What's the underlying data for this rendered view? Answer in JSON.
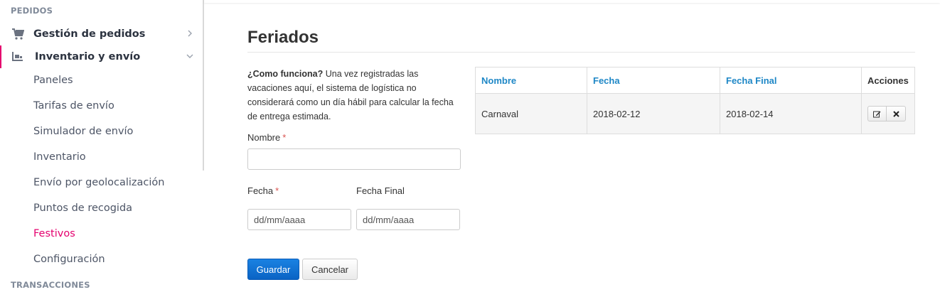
{
  "sidebar": {
    "section_orders": "PEDIDOS",
    "group_orders": "Gestión de pedidos",
    "group_inventory": "Inventario y envío",
    "items": [
      "Paneles",
      "Tarifas de envío",
      "Simulador de envío",
      "Inventario",
      "Envío por geolocalización",
      "Puntos de recogida",
      "Festivos",
      "Configuración"
    ],
    "section_transactions": "TRANSACCIONES",
    "active_item": "Festivos"
  },
  "page": {
    "title": "Feriados",
    "help_bold": "¿Como funciona?",
    "help_text": " Una vez registradas las vacaciones aquí, el sistema de logística no considerará como un día hábil para calcular la fecha de entrega estimada."
  },
  "form": {
    "name_label": "Nombre",
    "name_value": "",
    "date_label": "Fecha",
    "date_placeholder": "dd/mm/aaaa",
    "end_date_label": "Fecha Final",
    "end_date_placeholder": "dd/mm/aaaa",
    "required_mark": "*",
    "save_label": "Guardar",
    "cancel_label": "Cancelar"
  },
  "table": {
    "headers": [
      "Nombre",
      "Fecha",
      "Fecha Final",
      "Acciones"
    ],
    "rows": [
      {
        "name": "Carnaval",
        "date": "2018-02-12",
        "end_date": "2018-02-14"
      }
    ]
  },
  "colors": {
    "accent": "#e4006e",
    "link": "#1e87c6",
    "primary_button": "#0a63c4"
  },
  "icons": [
    "cart-icon",
    "inventory-icon",
    "chevron-right-icon",
    "chevron-down-icon",
    "edit-icon",
    "delete-icon"
  ]
}
